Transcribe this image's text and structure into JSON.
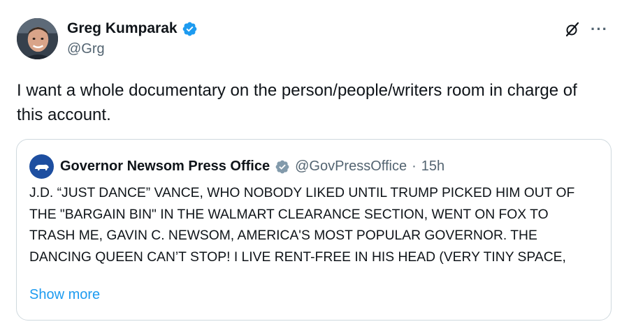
{
  "author": {
    "display_name": "Greg Kumparak",
    "handle": "@Grg",
    "verified": true,
    "verified_color": "#1d9bf0"
  },
  "tweet": {
    "text": "I want a whole documentary on the person/people/writers room in charge of this account."
  },
  "icons": {
    "grok": "grok-icon",
    "more": "···"
  },
  "quote": {
    "display_name": "Governor Newsom Press Office",
    "handle": "@GovPressOffice",
    "separator": "·",
    "time": "15h",
    "verified_color": "#829aab",
    "text": "J.D. “JUST DANCE” VANCE, WHO NOBODY LIKED UNTIL TRUMP PICKED HIM OUT OF THE \"BARGAIN BIN\" IN THE WALMART CLEARANCE SECTION, WENT ON FOX TO TRASH ME, GAVIN C. NEWSOM, AMERICA'S MOST POPULAR GOVERNOR. THE DANCING QUEEN CAN’T STOP! I LIVE RENT-FREE IN HIS HEAD (VERY TINY SPACE,",
    "show_more_label": "Show more"
  },
  "colors": {
    "text_primary": "#0f1419",
    "text_secondary": "#536471",
    "link": "#1d9bf0",
    "border": "#cfd9de"
  }
}
